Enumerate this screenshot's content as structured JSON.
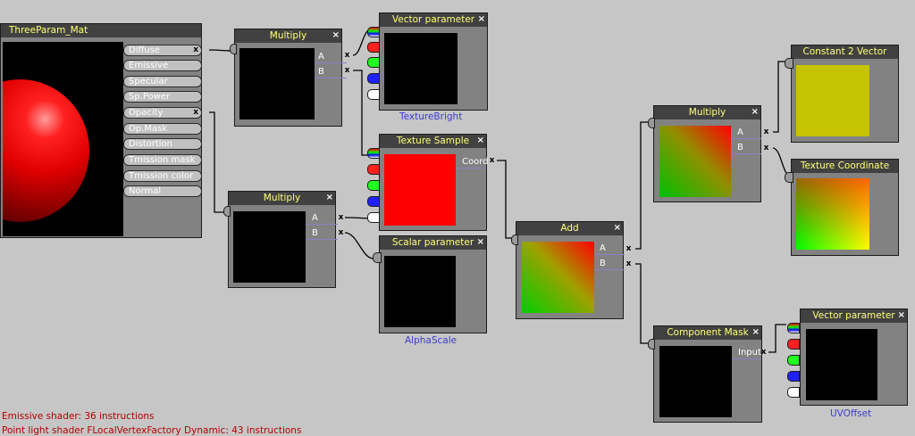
{
  "material": {
    "title": "ThreeParam_Mat",
    "slots": [
      "Diffuse",
      "Emissive",
      "Specular",
      "Sp.Power",
      "Opacity",
      "Op.Mask",
      "Distortion",
      "Tmission mask",
      "Tmission color",
      "Normal"
    ]
  },
  "nodes": {
    "multiply_top": {
      "title": "Multiply",
      "in_a": "A",
      "in_b": "B"
    },
    "vector_param_top": {
      "title": "Vector parameter",
      "caption": "TextureBright"
    },
    "multiply_mid": {
      "title": "Multiply",
      "in_a": "A",
      "in_b": "B"
    },
    "texture_sample": {
      "title": "Texture Sample",
      "in_coord": "Coord"
    },
    "scalar_param": {
      "title": "Scalar parameter",
      "caption": "AlphaScale"
    },
    "add": {
      "title": "Add",
      "in_a": "A",
      "in_b": "B"
    },
    "multiply_right": {
      "title": "Multiply",
      "in_a": "A",
      "in_b": "B"
    },
    "constant2": {
      "title": "Constant 2 Vector"
    },
    "tex_coord": {
      "title": "Texture Coordinate"
    },
    "component_mask": {
      "title": "Component Mask",
      "in_input": "Input"
    },
    "vector_param_bottom": {
      "title": "Vector parameter",
      "caption": "UVOffset"
    }
  },
  "close_glyph": "×",
  "pin_close_glyph": "x",
  "status": {
    "line1": "Emissive shader: 36 instructions",
    "line2": "Point light shader FLocalVertexFactory Dynamic: 43 instructions"
  },
  "colors": {
    "canvas": "#c6c6c6",
    "node_body": "#828282",
    "title_bar": "#414141",
    "title_text": "#ffff7a",
    "wire": "#000000",
    "caption": "#3c3cd0",
    "status_text": "#b40000",
    "constant_preview": "#c6c300",
    "texture_preview": "#ff0000"
  }
}
